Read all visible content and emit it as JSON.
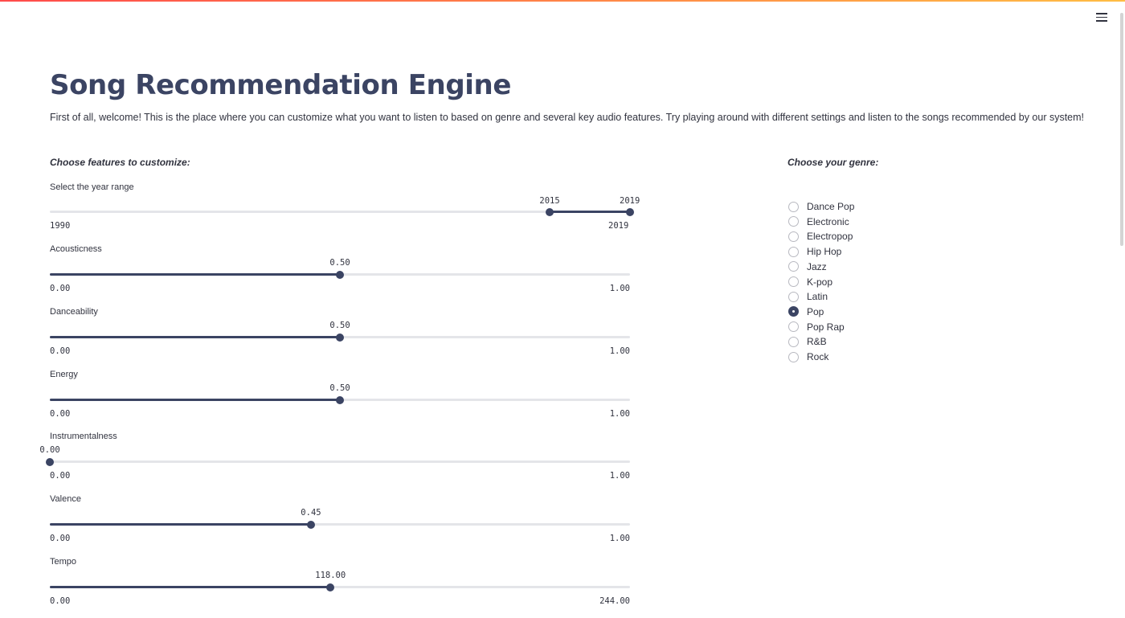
{
  "app": {
    "title": "Song Recommendation Engine",
    "intro": "First of all, welcome! This is the place where you can customize what you want to listen to based on genre and several key audio features. Try playing around with different settings and listen to the songs recommended by our system!"
  },
  "features": {
    "heading": "Choose features to customize:",
    "year_range": {
      "label": "Select the year range",
      "min": 1990,
      "max": 2019,
      "low": 2015,
      "high": 2019,
      "min_label": "1990",
      "max_label": "2019",
      "low_label": "2015",
      "high_label": "2019"
    },
    "sliders": [
      {
        "label": "Acousticness",
        "min": 0,
        "max": 1,
        "value": 0.5,
        "value_label": "0.50",
        "min_label": "0.00",
        "max_label": "1.00"
      },
      {
        "label": "Danceability",
        "min": 0,
        "max": 1,
        "value": 0.5,
        "value_label": "0.50",
        "min_label": "0.00",
        "max_label": "1.00"
      },
      {
        "label": "Energy",
        "min": 0,
        "max": 1,
        "value": 0.5,
        "value_label": "0.50",
        "min_label": "0.00",
        "max_label": "1.00"
      },
      {
        "label": "Instrumentalness",
        "min": 0,
        "max": 1,
        "value": 0.0,
        "value_label": "0.00",
        "min_label": "0.00",
        "max_label": "1.00"
      },
      {
        "label": "Valence",
        "min": 0,
        "max": 1,
        "value": 0.45,
        "value_label": "0.45",
        "min_label": "0.00",
        "max_label": "1.00"
      },
      {
        "label": "Tempo",
        "min": 0,
        "max": 244,
        "value": 118,
        "value_label": "118.00",
        "min_label": "0.00",
        "max_label": "244.00"
      }
    ]
  },
  "genre": {
    "heading": "Choose your genre:",
    "options": [
      "Dance Pop",
      "Electronic",
      "Electropop",
      "Hip Hop",
      "Jazz",
      "K-pop",
      "Latin",
      "Pop",
      "Pop Rap",
      "R&B",
      "Rock"
    ],
    "selected": "Pop"
  },
  "colors": {
    "accent": "#3b4463",
    "track": "#e4e5e9",
    "text": "#31333f"
  },
  "icons": {
    "menu": "hamburger-menu-icon"
  }
}
